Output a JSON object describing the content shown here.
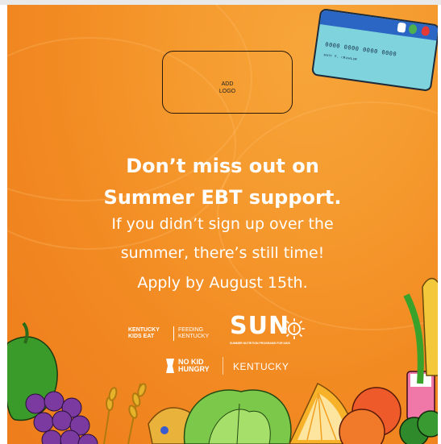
{
  "logo_placeholder": {
    "text": "ADD\nLOGO"
  },
  "card": {
    "number": "0000 0000 0000 0000",
    "name": "ᴍᴀᴛᴛ ʏ. ᴄʀᴀᴡʟᴇʀ"
  },
  "headline": {
    "line1": "Don’t miss out on",
    "line2": "Summer EBT support."
  },
  "body": {
    "line1": "If you didn’t sign up over the",
    "line2": "summer, there’s still time!",
    "line3": "Apply by August 15th."
  },
  "logos": {
    "kentucky_kids_eat": "KENTUCKY\nKIDS EAT",
    "feeding_kentucky": "FEEDING\nKENTUCKY",
    "sun": "SUN",
    "sun_subtitle": "SUMMER NUTRITION PROGRAMS FOR KIDS",
    "no_kid_hungry": "NO KID\nHUNGRY",
    "kentucky": "KENTUCKY"
  },
  "colors": {
    "background": "#f28a22",
    "text": "#ffffff",
    "card": "#7fd3dc",
    "card_stripe": "#2c66c4"
  }
}
